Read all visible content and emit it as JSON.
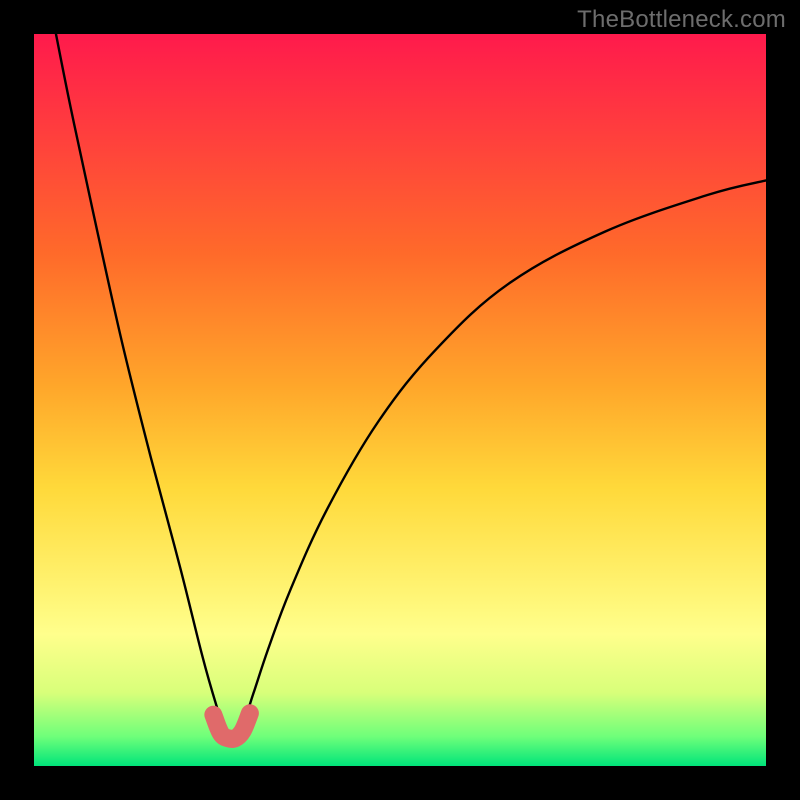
{
  "watermark": "TheBottleneck.com",
  "colors": {
    "background": "#000000",
    "gradient_top": "#ff1a4c",
    "gradient_bottom": "#00e47a",
    "curve": "#000000",
    "highlight": "#e06a6a"
  },
  "chart_data": {
    "type": "line",
    "title": "",
    "xlabel": "",
    "ylabel": "",
    "xlim": [
      0,
      100
    ],
    "ylim": [
      0,
      100
    ],
    "grid": false,
    "legend": false,
    "description": "Sharp V-shaped curve with a narrow minimum near x≈27; right branch rises and flattens toward the upper-right; minimum segment is highlighted.",
    "series": [
      {
        "name": "curve",
        "x": [
          3,
          5,
          8,
          12,
          16,
          20,
          23,
          25,
          26,
          27,
          28,
          29,
          30,
          32,
          35,
          40,
          47,
          55,
          65,
          78,
          92,
          100
        ],
        "y": [
          100,
          90,
          76,
          58,
          42,
          27,
          15,
          8,
          5,
          4,
          5,
          7,
          10,
          16,
          24,
          35,
          47,
          57,
          66,
          73,
          78,
          80
        ]
      },
      {
        "name": "highlight",
        "x": [
          24.5,
          25.5,
          26.5,
          27.5,
          28.5,
          29.5
        ],
        "y": [
          7,
          4.5,
          3.8,
          3.8,
          4.8,
          7.2
        ]
      }
    ]
  }
}
